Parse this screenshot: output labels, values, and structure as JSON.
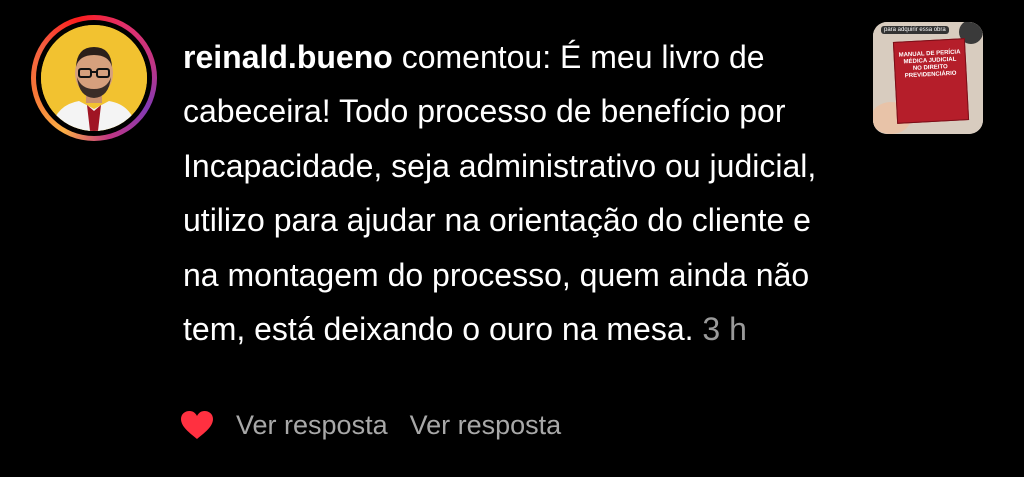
{
  "comment": {
    "username": "reinald.bueno",
    "verb": " comentou: ",
    "text": "É meu livro de cabeceira! Todo processo de benefício por Incapacidade, seja administrativo ou judicial, utilizo para ajudar na orientação do cliente e na montagem do processo, quem ainda não tem, está deixando o ouro na mesa.",
    "time": "3 h"
  },
  "actions": {
    "like_icon": "heart-icon",
    "like_color": "#ff3040",
    "reply1": "Ver resposta",
    "reply2": "Ver resposta"
  },
  "thumbnail": {
    "label": "para adquirir essa obra",
    "book_title": "MANUAL DE PERÍCIA MÉDICA JUDICIAL NO DIREITO PREVIDENCIÁRIO"
  }
}
